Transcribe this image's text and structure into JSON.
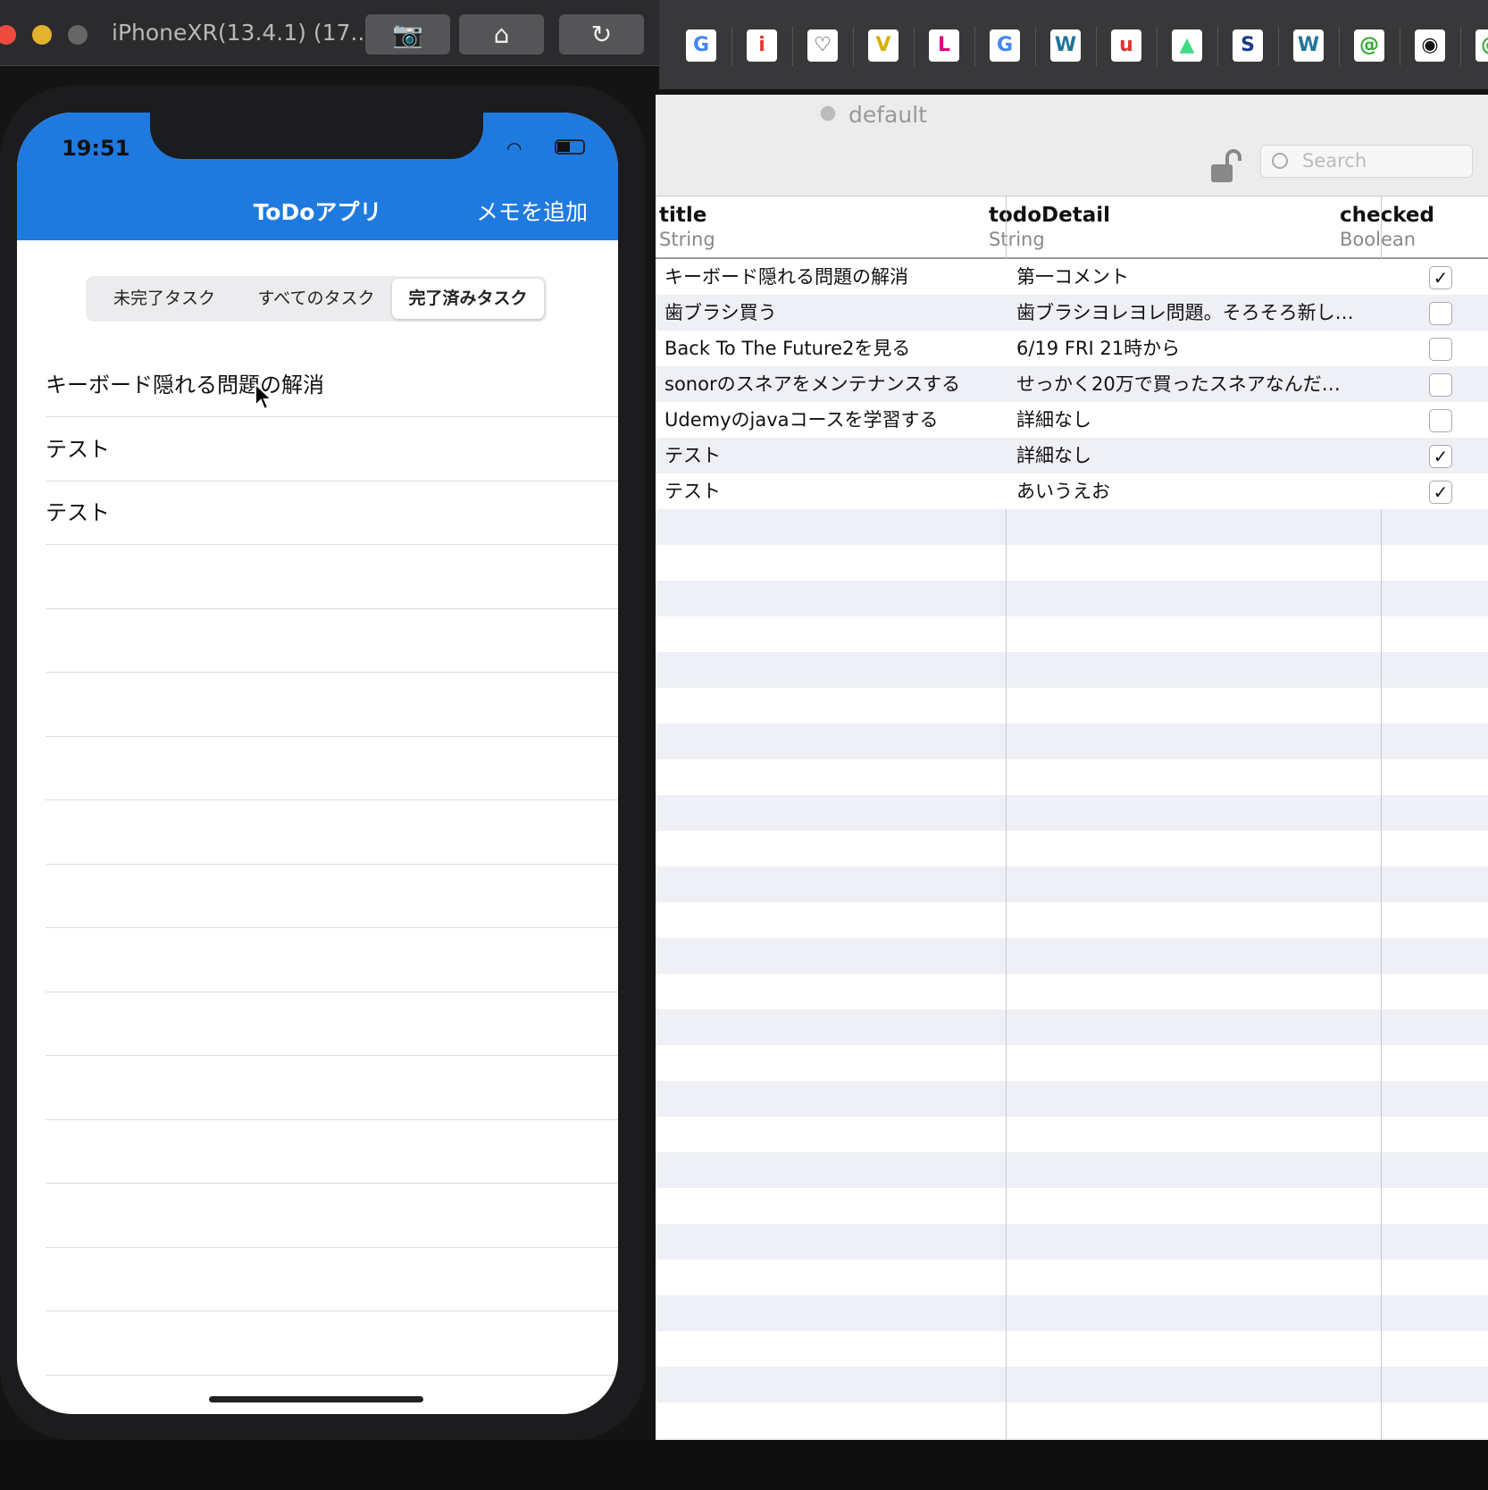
{
  "simulator": {
    "title": "iPhoneXR(13.4.1) (17...",
    "buttons": [
      {
        "icon": "camera-icon",
        "glyph": "📷"
      },
      {
        "icon": "home-icon",
        "glyph": "⌂"
      },
      {
        "icon": "rotate-icon",
        "glyph": "↻"
      }
    ]
  },
  "bookmarks": [
    {
      "g": "G",
      "c": "#4285f4"
    },
    {
      "g": "i",
      "c": "#e33"
    },
    {
      "g": "♡",
      "c": "#333"
    },
    {
      "g": "V",
      "c": "#d4b000"
    },
    {
      "g": "L",
      "c": "#e4007f"
    },
    {
      "g": "G",
      "c": "#4285f4"
    },
    {
      "g": "W",
      "c": "#21759b"
    },
    {
      "g": "u",
      "c": "#d33"
    },
    {
      "g": "▲",
      "c": "#3ddc84"
    },
    {
      "g": "S",
      "c": "#1a3a8a"
    },
    {
      "g": "W",
      "c": "#21759b"
    },
    {
      "g": "@",
      "c": "#3a3"
    },
    {
      "g": "◉",
      "c": "#111"
    },
    {
      "g": "@",
      "c": "#3a3"
    }
  ],
  "phone": {
    "time": "19:51",
    "nav_title": "ToDoアプリ",
    "add_button": "メモを追加",
    "segments": [
      "未完了タスク",
      "すべてのタスク",
      "完了済みタスク"
    ],
    "selected_segment": 2,
    "items": [
      "キーボード隠れる問題の解消",
      "テスト",
      "テスト"
    ]
  },
  "realm": {
    "realm_name": "default",
    "search_placeholder": "Search",
    "columns": [
      {
        "name": "title",
        "type": "String"
      },
      {
        "name": "todoDetail",
        "type": "String"
      },
      {
        "name": "checked",
        "type": "Boolean"
      }
    ],
    "rows": [
      {
        "title": "キーボード隠れる問題の解消",
        "detail": "第一コメント",
        "checked": true
      },
      {
        "title": "歯ブラシ買う",
        "detail": "歯ブラシヨレヨレ問題。そろそろ新し…",
        "checked": false
      },
      {
        "title": "Back To The Future2を見る",
        "detail": "6/19 FRI 21時から",
        "checked": false
      },
      {
        "title": "sonorのスネアをメンテナンスする",
        "detail": "せっかく20万で買ったスネアなんだ…",
        "checked": false
      },
      {
        "title": "Udemyのjavaコースを学習する",
        "detail": "詳細なし",
        "checked": false
      },
      {
        "title": "テスト",
        "detail": "詳細なし",
        "checked": true
      },
      {
        "title": "テスト",
        "detail": "あいうえお",
        "checked": true
      }
    ]
  },
  "checkmark": "✓"
}
